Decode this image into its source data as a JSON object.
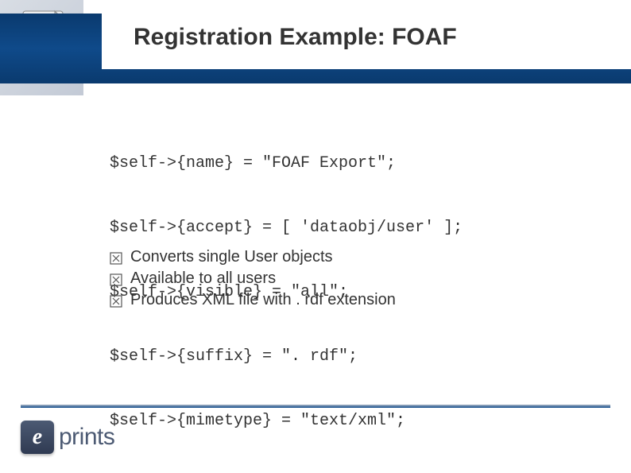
{
  "title": "Registration Example: FOAF",
  "code_lines": [
    "$self->{name} = \"FOAF Export\";",
    "$self->{accept} = [ 'dataobj/user' ];",
    "$self->{visible} = \"all\";",
    "$self->{suffix} = \". rdf\";",
    "$self->{mimetype} = \"text/xml\";"
  ],
  "bullets": [
    "Converts single User objects",
    "Available to all users",
    "Produces XML file with . rdf extension"
  ],
  "logo": {
    "mark": "e",
    "text": "prints"
  }
}
